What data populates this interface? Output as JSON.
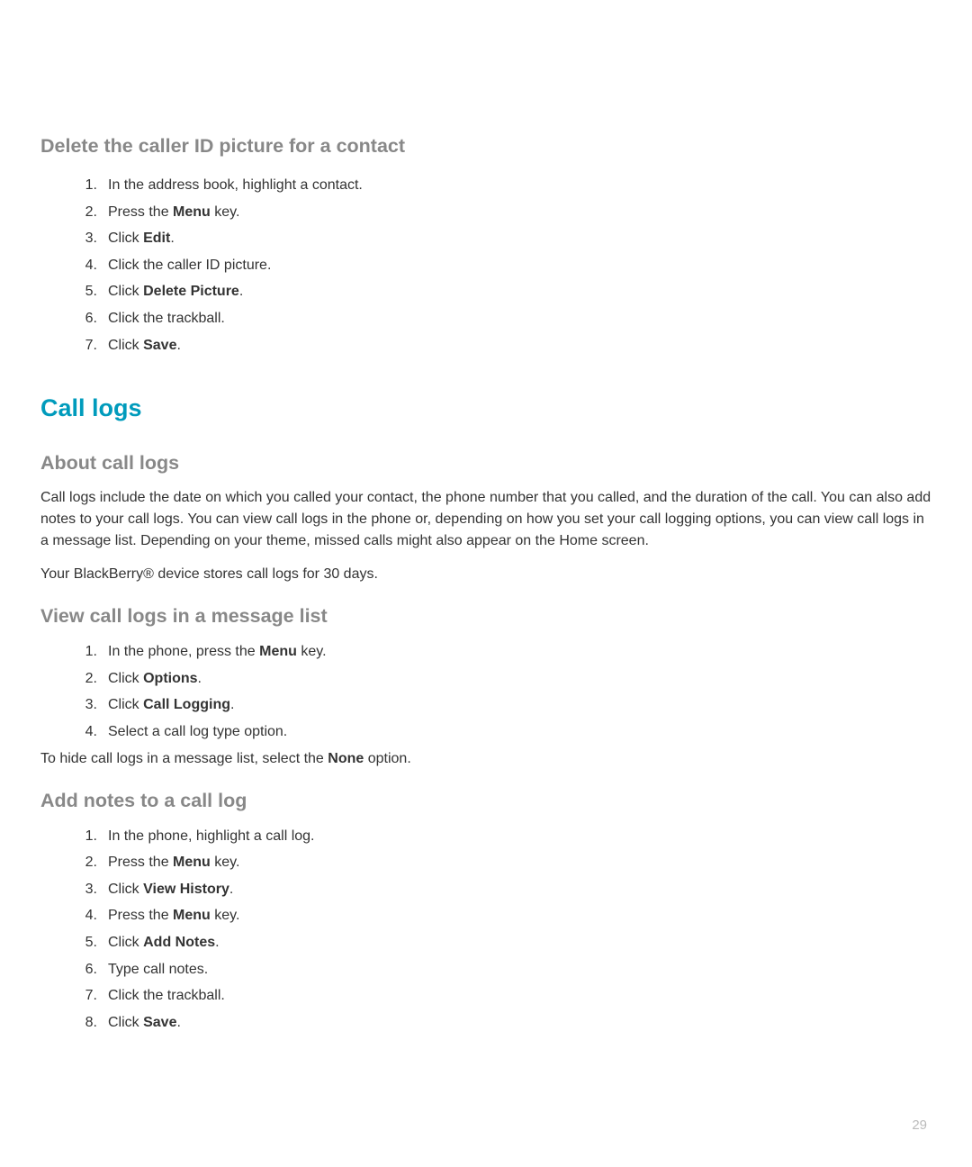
{
  "section1": {
    "heading": "Delete the caller ID picture for a contact",
    "steps": [
      {
        "prefix": "In the address book, highlight a contact."
      },
      {
        "prefix": "Press the ",
        "bold": "Menu",
        "suffix": " key."
      },
      {
        "prefix": "Click ",
        "bold": "Edit",
        "suffix": "."
      },
      {
        "prefix": "Click the caller ID picture."
      },
      {
        "prefix": "Click ",
        "bold": "Delete Picture",
        "suffix": "."
      },
      {
        "prefix": "Click the trackball."
      },
      {
        "prefix": "Click ",
        "bold": "Save",
        "suffix": "."
      }
    ]
  },
  "section2": {
    "heading": "Call logs"
  },
  "section3": {
    "heading": "About call logs",
    "para1": "Call logs include the date on which you called your contact, the phone number that you called, and the duration of the call. You can also add notes to your call logs. You can view call logs in the phone or, depending on how you set your call logging options, you can view call logs in a message list. Depending on your theme, missed calls might also appear on the Home screen.",
    "para2": "Your BlackBerry® device stores call logs for 30 days."
  },
  "section4": {
    "heading": "View call logs in a message list",
    "steps": [
      {
        "prefix": "In the phone, press the ",
        "bold": "Menu",
        "suffix": " key."
      },
      {
        "prefix": "Click ",
        "bold": "Options",
        "suffix": "."
      },
      {
        "prefix": "Click ",
        "bold": "Call Logging",
        "suffix": "."
      },
      {
        "prefix": "Select a call log type option."
      }
    ],
    "note_prefix": "To hide call logs in a message list, select the ",
    "note_bold": "None",
    "note_suffix": " option."
  },
  "section5": {
    "heading": "Add notes to a call log",
    "steps": [
      {
        "prefix": "In the phone, highlight a call log."
      },
      {
        "prefix": "Press the ",
        "bold": "Menu",
        "suffix": " key."
      },
      {
        "prefix": "Click ",
        "bold": "View History",
        "suffix": "."
      },
      {
        "prefix": "Press the ",
        "bold": "Menu",
        "suffix": " key."
      },
      {
        "prefix": "Click ",
        "bold": "Add Notes",
        "suffix": "."
      },
      {
        "prefix": "Type call notes."
      },
      {
        "prefix": "Click the trackball."
      },
      {
        "prefix": "Click ",
        "bold": "Save",
        "suffix": "."
      }
    ]
  },
  "pageNumber": "29"
}
